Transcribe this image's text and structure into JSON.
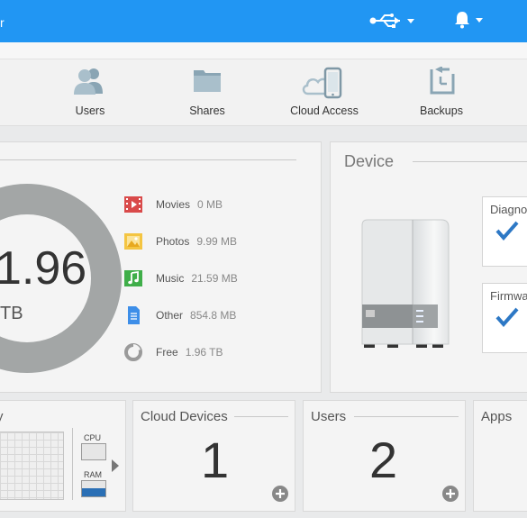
{
  "topbar": {
    "fragment": "r"
  },
  "nav": {
    "items": [
      {
        "label": "Users",
        "icon": "users-icon"
      },
      {
        "label": "Shares",
        "icon": "folder-icon"
      },
      {
        "label": "Cloud Access",
        "icon": "cloud-phone-icon"
      },
      {
        "label": "Backups",
        "icon": "backup-icon"
      }
    ]
  },
  "storage": {
    "capacity_value": "1.96",
    "capacity_unit": "TB",
    "legend": [
      {
        "name": "Movies",
        "value": "0 MB",
        "color": "#d94a4a",
        "icon": "film-icon"
      },
      {
        "name": "Photos",
        "value": "9.99 MB",
        "color": "#f4c542",
        "icon": "photo-icon"
      },
      {
        "name": "Music",
        "value": "21.59 MB",
        "color": "#3fae49",
        "icon": "music-icon"
      },
      {
        "name": "Other",
        "value": "854.8 MB",
        "color": "#3d8ee8",
        "icon": "document-icon"
      },
      {
        "name": "Free",
        "value": "1.96 TB",
        "color": "#9a9a9a",
        "icon": "pie-icon"
      }
    ]
  },
  "device": {
    "title": "Device",
    "cards": [
      {
        "title": "Diagnostics"
      },
      {
        "title": "Firmware"
      }
    ]
  },
  "tiles": {
    "diagnostics": {
      "title_fragment": "y",
      "cpu_label": "CPU",
      "ram_label": "RAM"
    },
    "cloud_devices": {
      "title": "Cloud Devices",
      "count": "1"
    },
    "users": {
      "title": "Users",
      "count": "2"
    },
    "apps": {
      "title": "Apps"
    }
  },
  "colors": {
    "accent": "#2196f3",
    "check": "#2d78c5"
  }
}
